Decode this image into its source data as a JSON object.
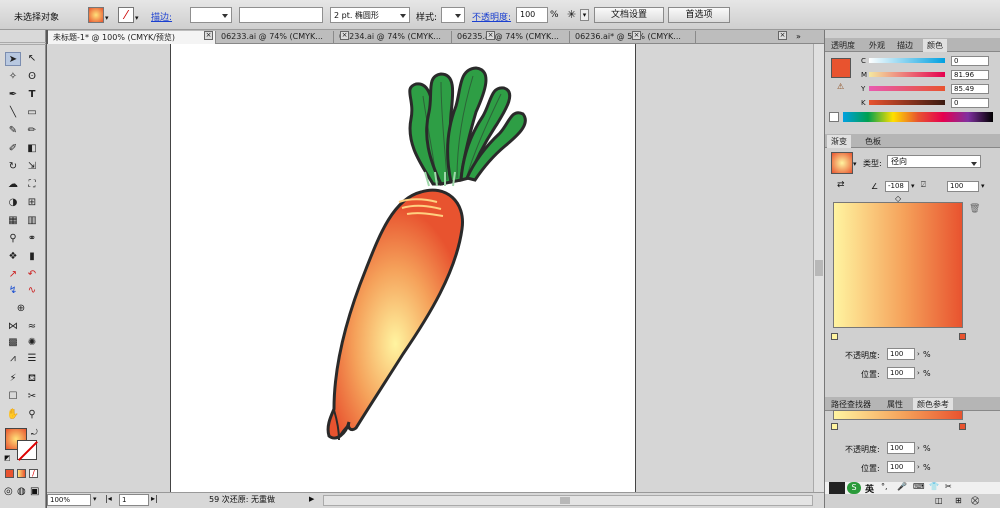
{
  "control_bar": {
    "selection_label": "未选择对象",
    "stroke_label": "描边:",
    "stroke_style": "2 pt. 椭圆形",
    "style_label": "样式:",
    "opacity_label": "不透明度:",
    "opacity_value": "100",
    "percent": "%",
    "doc_settings": "文档设置",
    "preferences": "首选项"
  },
  "tabs": [
    {
      "label": "未标题-1* @ 100% (CMYK/预览)"
    },
    {
      "label": "06233.ai @ 74% (CMYK..."
    },
    {
      "label": "06234.ai @ 74% (CMYK..."
    },
    {
      "label": "06235.ai @ 74% (CMYK..."
    },
    {
      "label": "06236.ai* @ 50% (CMYK..."
    }
  ],
  "color_panel": {
    "tabs": [
      "透明度",
      "外观",
      "描边",
      "颜色"
    ],
    "swatch_color": "#E8532F",
    "sliders": [
      {
        "label": "C",
        "value": "0"
      },
      {
        "label": "M",
        "value": "81.96"
      },
      {
        "label": "Y",
        "value": "85.49"
      },
      {
        "label": "K",
        "value": "0"
      }
    ]
  },
  "gradient_panel": {
    "tabs": [
      "渐变",
      "色板"
    ],
    "type_label": "类型:",
    "type_value": "径向",
    "angle_value": "-108",
    "ratio_value": "100",
    "start_color": "#FFF4A0",
    "end_color": "#E8532F",
    "opacity_label": "不透明度:",
    "opacity_value": "100",
    "position_label": "位置:",
    "position_value": "100",
    "percent": "%"
  },
  "lower_panel": {
    "tabs": [
      "路径查找器",
      "属性",
      "颜色参考"
    ],
    "opacity_label": "不透明度:",
    "opacity_value": "100",
    "position_label": "位置:",
    "position_value": "100",
    "percent": "%",
    "taskbar_char": "英"
  },
  "status_bar": {
    "zoom": "100%",
    "page": "1",
    "message": "59 次还原: 无重做"
  },
  "colors": {
    "carrot_orange": "#E8532F",
    "carrot_light": "#FFF4A0",
    "leaf_green": "#2E9E45",
    "outline": "#2A2A2A"
  }
}
